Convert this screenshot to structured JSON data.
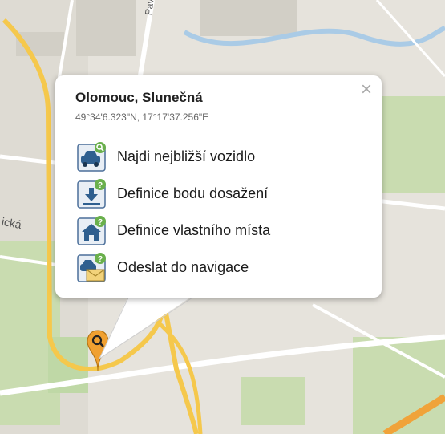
{
  "map": {
    "streets": {
      "pavelkova": "Pavelkova",
      "left_cut": "ická"
    }
  },
  "popup": {
    "title": "Olomouc, Slunečná",
    "coords": "49°34'6.323\"N, 17°17'37.256\"E",
    "close_glyph": "×",
    "items": [
      {
        "label": "Najdi nejbližší vozidlo",
        "icon": "car-search-icon"
      },
      {
        "label": "Definice bodu dosažení",
        "icon": "download-point-icon"
      },
      {
        "label": "Definice vlastního místa",
        "icon": "house-place-icon"
      },
      {
        "label": "Odeslat do navigace",
        "icon": "car-mail-icon"
      }
    ]
  },
  "colors": {
    "accent_green": "#6ab04c",
    "icon_blue": "#2f5f8f",
    "marker_orange": "#f0a030",
    "road_yellow": "#f5c84c",
    "road_orange": "#f0a33a"
  }
}
